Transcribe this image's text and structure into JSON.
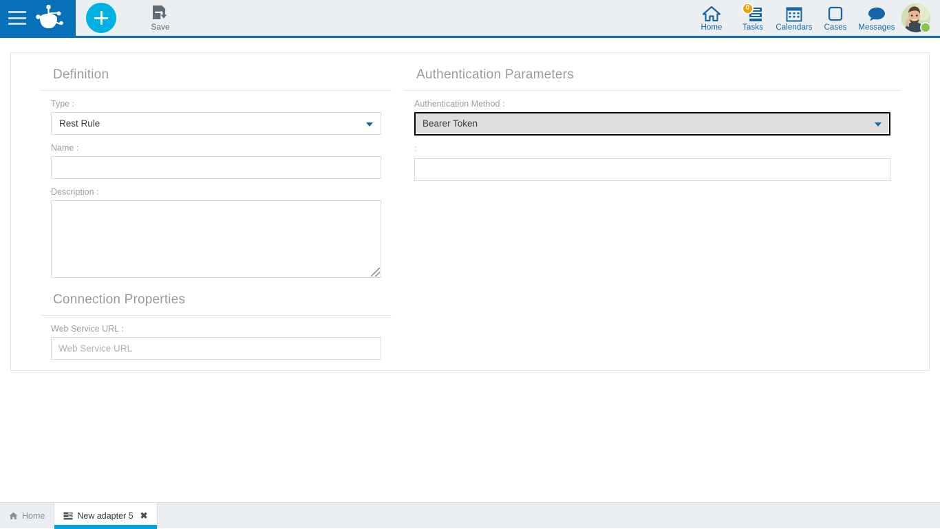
{
  "topbar": {
    "menu_icon": "hamburger-icon",
    "logo_icon": "bonita-logo-icon",
    "add_label": "+",
    "save_label": "Save",
    "save_icon": "floppy-disk-download-icon",
    "nav": [
      {
        "id": "home",
        "label": "Home",
        "icon": "house-icon",
        "badge": null
      },
      {
        "id": "tasks",
        "label": "Tasks",
        "icon": "task-list-icon",
        "badge": "0"
      },
      {
        "id": "calendars",
        "label": "Calendars",
        "icon": "calendar-icon",
        "badge": null
      },
      {
        "id": "cases",
        "label": "Cases",
        "icon": "rounded-square-icon",
        "badge": null
      },
      {
        "id": "messages",
        "label": "Messages",
        "icon": "speech-bubble-icon",
        "badge": null
      }
    ],
    "avatar": {
      "name": "avatar",
      "status": "online"
    }
  },
  "colors": {
    "brand_blue": "#0670b8",
    "accent_cyan": "#00b2e3",
    "nav_blue": "#1565a8",
    "badge_orange": "#f0a202",
    "status_green": "#8bc34a",
    "tab_progress": "#00a3e0"
  },
  "form": {
    "definition": {
      "title": "Definition",
      "type_label": "Type :",
      "type_value": "Rest Rule",
      "name_label": "Name :",
      "name_value": "",
      "description_label": "Description :",
      "description_value": ""
    },
    "connection": {
      "title": "Connection Properties",
      "url_label": "Web Service URL :",
      "url_value": "",
      "url_placeholder": "Web Service URL"
    },
    "auth": {
      "title": "Authentication Parameters",
      "method_label": "Authentication Method :",
      "method_value": "Bearer Token",
      "token_label": ":",
      "token_value": ""
    }
  },
  "tabs": [
    {
      "id": "home",
      "label": "Home",
      "icon": "house-icon",
      "active": false,
      "closable": false
    },
    {
      "id": "adapter",
      "label": "New adapter 5",
      "icon": "adapter-icon",
      "active": true,
      "closable": true,
      "close_label": "✖"
    }
  ]
}
